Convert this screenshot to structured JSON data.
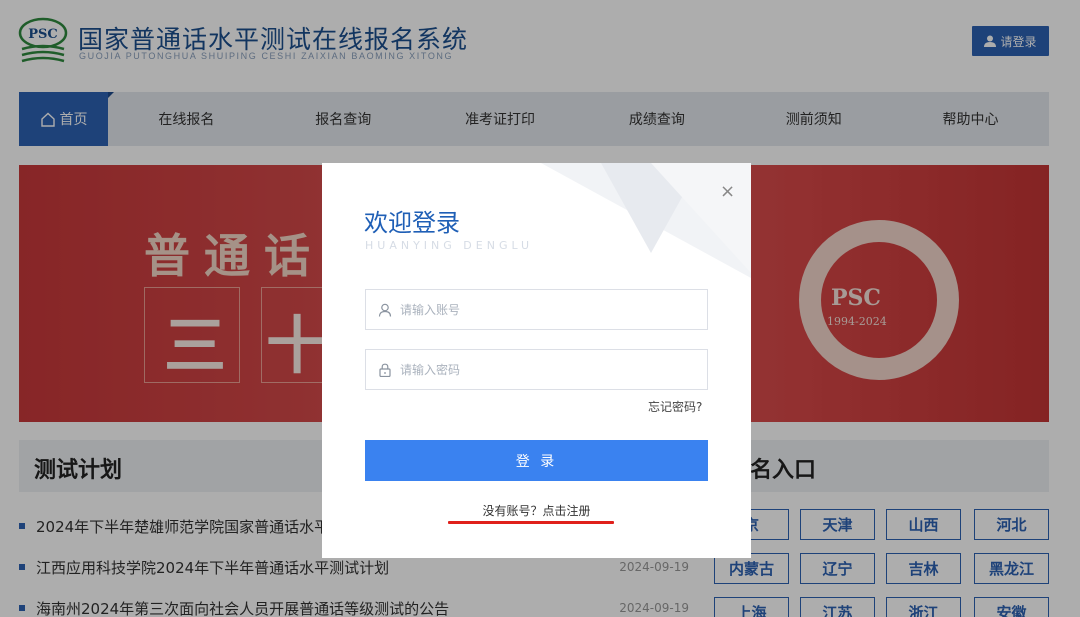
{
  "header": {
    "logo_text": "PSC",
    "title": "国家普通话水平测试在线报名系统",
    "subtitle": "GUOJIA PUTONGHUA SHUIPING CESHI ZAIXIAN BAOMING XITONG",
    "login_label": "请登录"
  },
  "nav": {
    "home": "首页",
    "items": [
      "在线报名",
      "报名查询",
      "准考证打印",
      "成绩查询",
      "测前须知",
      "帮助中心"
    ]
  },
  "banner": {
    "line1": "普通话",
    "line2": "三十",
    "logo": "PSC",
    "years": "1994-2024"
  },
  "plan": {
    "title": "测试计划",
    "items": [
      {
        "text": "2024年下半年楚雄师范学院国家普通话水平",
        "date": ""
      },
      {
        "text": "江西应用科技学院2024年下半年普通话水平测试计划",
        "date": "2024-09-19"
      },
      {
        "text": "海南州2024年第三次面向社会人员开展普通话等级测试的公告",
        "date": "2024-09-19"
      }
    ]
  },
  "entry": {
    "title": "名入口",
    "provinces": [
      "京",
      "天津",
      "山西",
      "河北",
      "内蒙古",
      "辽宁",
      "吉林",
      "黑龙江",
      "上海",
      "江苏",
      "浙江",
      "安徽"
    ]
  },
  "modal": {
    "close": "×",
    "title": "欢迎登录",
    "subtitle": "HUANYING DENGLU",
    "account_placeholder": "请输入账号",
    "password_placeholder": "请输入密码",
    "forgot": "忘记密码?",
    "submit": "登 录",
    "register": "没有账号？点击注册"
  },
  "colors": {
    "brand": "#2d62b3",
    "button": "#3a82f0",
    "highlight": "#e0201b"
  }
}
